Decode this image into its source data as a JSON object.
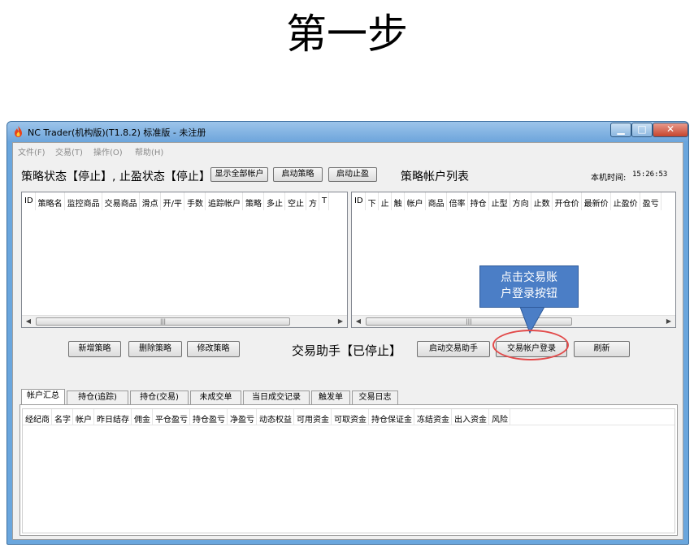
{
  "slide": {
    "title": "第一步"
  },
  "window": {
    "title": "NC Trader(机构版)(T1.8.2) 标准版 - 未注册",
    "minimize": "▁",
    "maximize": "□",
    "close": "✕"
  },
  "menu": [
    "文件(F)",
    "交易(T)",
    "操作(O)",
    "帮助(H)"
  ],
  "status_row": {
    "strategy_status": "策略状态【停止】, 止盈状态【停止】",
    "show_all_accounts": "显示全部帐户",
    "start_strategy": "启动策略",
    "start_take_profit": "启动止盈",
    "account_list_title": "策略帐户列表",
    "local_time_label": "本机时间:",
    "local_time_value": "15:26:53"
  },
  "strategy_table": {
    "columns": [
      "ID",
      "策略名",
      "监控商品",
      "交易商品",
      "滑点",
      "开/平",
      "手数",
      "追踪帐户",
      "策略",
      "多止",
      "空止",
      "方",
      "T"
    ]
  },
  "account_table": {
    "columns": [
      "ID",
      "下",
      "止",
      "触",
      "帐户",
      "商品",
      "倍率",
      "持仓",
      "止型",
      "方向",
      "止数",
      "开仓价",
      "最新价",
      "止盈价",
      "盈亏"
    ]
  },
  "scroll": {
    "left": "◀",
    "right": "▶",
    "grip": "|||"
  },
  "action_row": {
    "add_strategy": "新增策略",
    "delete_strategy": "删除策略",
    "edit_strategy": "修改策略",
    "assistant_status": "交易助手【已停止】",
    "start_assistant": "启动交易助手",
    "account_login": "交易帐户登录",
    "refresh": "刷新"
  },
  "callout": {
    "line1": "点击交易账",
    "line2": "户登录按钮"
  },
  "tabs": [
    "帐户汇总",
    "持仓(追踪)",
    "持仓(交易)",
    "未成交单",
    "当日成交记录",
    "触发单",
    "交易日志"
  ],
  "summary_table": {
    "columns": [
      "经纪商",
      "名字",
      "帐户",
      "昨日结存",
      "佣金",
      "平仓盈亏",
      "持仓盈亏",
      "净盈亏",
      "动态权益",
      "可用资金",
      "可取资金",
      "持仓保证金",
      "冻结资金",
      "出入资金",
      "风险"
    ]
  },
  "colors": {
    "titlebar": "#6fa6dc",
    "callout_fill": "#4b7ec6",
    "highlight_ring": "#e24a4a"
  }
}
